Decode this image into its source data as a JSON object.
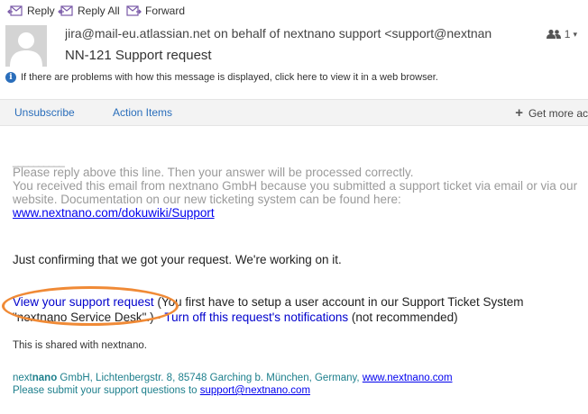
{
  "toolbar": {
    "reply": "Reply",
    "reply_all": "Reply All",
    "forward": "Forward"
  },
  "header": {
    "sender": "jira@mail-eu.atlassian.net on behalf of nextnano support <support@nextnan",
    "recipients_count": "1",
    "subject": "NN-121 Support request",
    "info_bar": "If there are problems with how this message is displayed, click here to view it in a web browser."
  },
  "action_bar": {
    "unsubscribe": "Unsubscribe",
    "action_items": "Action Items",
    "get_more": "Get more ac"
  },
  "email": {
    "separator": "__________",
    "reply_note": "Please reply above this line. Then your answer will be processed correctly.",
    "received_note": "You received this email from nextnano GmbH because you submitted a support ticket via email or via our website. Documentation on our new ticketing system can be found here:",
    "doc_link": "www.nextnano.com/dokuwiki/Support",
    "confirm": "Just confirming that we got your request. We're working on it.",
    "view_request_link": "View your support request",
    "setup_note": " (You first have to setup a user account in our Support Ticket System \"nextnano Service Desk\".) · ",
    "turn_off_link": "Turn off this request's notifications",
    "not_recommended": " (not recommended)",
    "shared": "This is shared with nextnano.",
    "footer_brand_prefix": "next",
    "footer_brand_bold": "nano",
    "footer_address": " GmbH, Lichtenbergstr. 8, 85748 Garching b. München, Germany, ",
    "footer_site_link": "www.nextnano.com",
    "footer_submit": "Please submit your support questions to ",
    "footer_email_link": "support@nextnano.com"
  },
  "colors": {
    "accent": "#2a6ebb",
    "link": "#0000ee",
    "highlight_ellipse": "#f08a36",
    "footer_teal": "#1d7f8c"
  }
}
